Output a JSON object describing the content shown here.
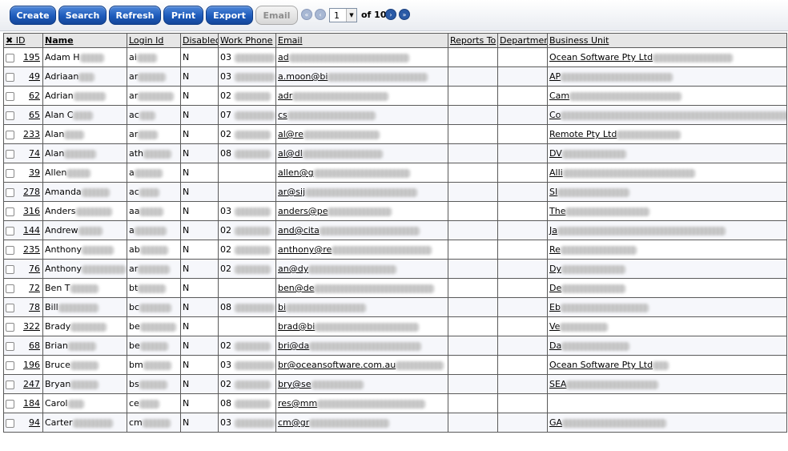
{
  "toolbar": {
    "create_label": "Create",
    "search_label": "Search",
    "refresh_label": "Refresh",
    "print_label": "Print",
    "export_label": "Export",
    "email_label": "Email",
    "email_disabled": true
  },
  "pagination": {
    "current_page": "1",
    "of_text": "of 10",
    "total_pages": 10
  },
  "table": {
    "headers": {
      "select_all": "✖",
      "id": "ID",
      "name": "Name",
      "login_id": "Login Id",
      "disabled": "Disabled",
      "work_phone": "Work Phone",
      "email": "Email",
      "reports_to": "Reports To",
      "department": "Department",
      "business_unit": "Business Unit"
    },
    "rows": [
      {
        "id": "195",
        "name": "Adam H",
        "login": "ai",
        "disabled": "N",
        "phone": "03",
        "email": "ad",
        "bu": "Ocean Software Pty Ltd"
      },
      {
        "id": "49",
        "name": "Adriaan",
        "login": "ar",
        "disabled": "N",
        "phone": "03",
        "email": "a.moon@bi",
        "bu": "AP"
      },
      {
        "id": "62",
        "name": "Adrian",
        "login": "ar",
        "disabled": "N",
        "phone": "02",
        "email": "adr",
        "bu": "Cam"
      },
      {
        "id": "65",
        "name": "Alan C",
        "login": "ac",
        "disabled": "N",
        "phone": "07",
        "email": "cs",
        "bu": "Co"
      },
      {
        "id": "233",
        "name": "Alan",
        "login": "ar",
        "disabled": "N",
        "phone": "02",
        "email": "al@re",
        "bu": "Remote Pty Ltd"
      },
      {
        "id": "74",
        "name": "Alan",
        "login": "ath",
        "disabled": "N",
        "phone": "08",
        "email": "al@dl",
        "bu": "DV"
      },
      {
        "id": "39",
        "name": "Allen",
        "login": "a",
        "disabled": "N",
        "phone": "",
        "email": "allen@g",
        "bu": "Alli"
      },
      {
        "id": "278",
        "name": "Amanda",
        "login": "ac",
        "disabled": "N",
        "phone": "",
        "email": "ar@sij",
        "bu": "SI"
      },
      {
        "id": "316",
        "name": "Anders",
        "login": "aa",
        "disabled": "N",
        "phone": "03",
        "email": "anders@pe",
        "bu": "The"
      },
      {
        "id": "144",
        "name": "Andrew",
        "login": "a",
        "disabled": "N",
        "phone": "02",
        "email": "and@cita",
        "bu": "Ja"
      },
      {
        "id": "235",
        "name": "Anthony",
        "login": "ab",
        "disabled": "N",
        "phone": "02",
        "email": "anthony@re",
        "bu": "Re"
      },
      {
        "id": "76",
        "name": "Anthony",
        "login": "ar",
        "disabled": "N",
        "phone": "02",
        "email": "an@dy",
        "bu": "Dy"
      },
      {
        "id": "72",
        "name": "Ben T",
        "login": "bt",
        "disabled": "N",
        "phone": "",
        "email": "ben@de",
        "bu": "De"
      },
      {
        "id": "78",
        "name": "Bill",
        "login": "bc",
        "disabled": "N",
        "phone": "08",
        "email": "bi",
        "bu": "Eb"
      },
      {
        "id": "322",
        "name": "Brady",
        "login": "be",
        "disabled": "N",
        "phone": "",
        "email": "brad@bi",
        "bu": "Ve"
      },
      {
        "id": "68",
        "name": "Brian",
        "login": "be",
        "disabled": "N",
        "phone": "02",
        "email": "bri@da",
        "bu": "Da"
      },
      {
        "id": "196",
        "name": "Bruce",
        "login": "bm",
        "disabled": "N",
        "phone": "03",
        "email": "br@oceansoftware.com.au",
        "bu": "Ocean Software Pty Ltd"
      },
      {
        "id": "247",
        "name": "Bryan",
        "login": "bs",
        "disabled": "N",
        "phone": "02",
        "email": "bry@se",
        "bu": "SEA"
      },
      {
        "id": "184",
        "name": "Carol",
        "login": "ce",
        "disabled": "N",
        "phone": "08",
        "email": "res@mm",
        "bu": ""
      },
      {
        "id": "94",
        "name": "Carter",
        "login": "cm",
        "disabled": "N",
        "phone": "03",
        "email": "cm@gr",
        "bu": "GA"
      }
    ]
  }
}
